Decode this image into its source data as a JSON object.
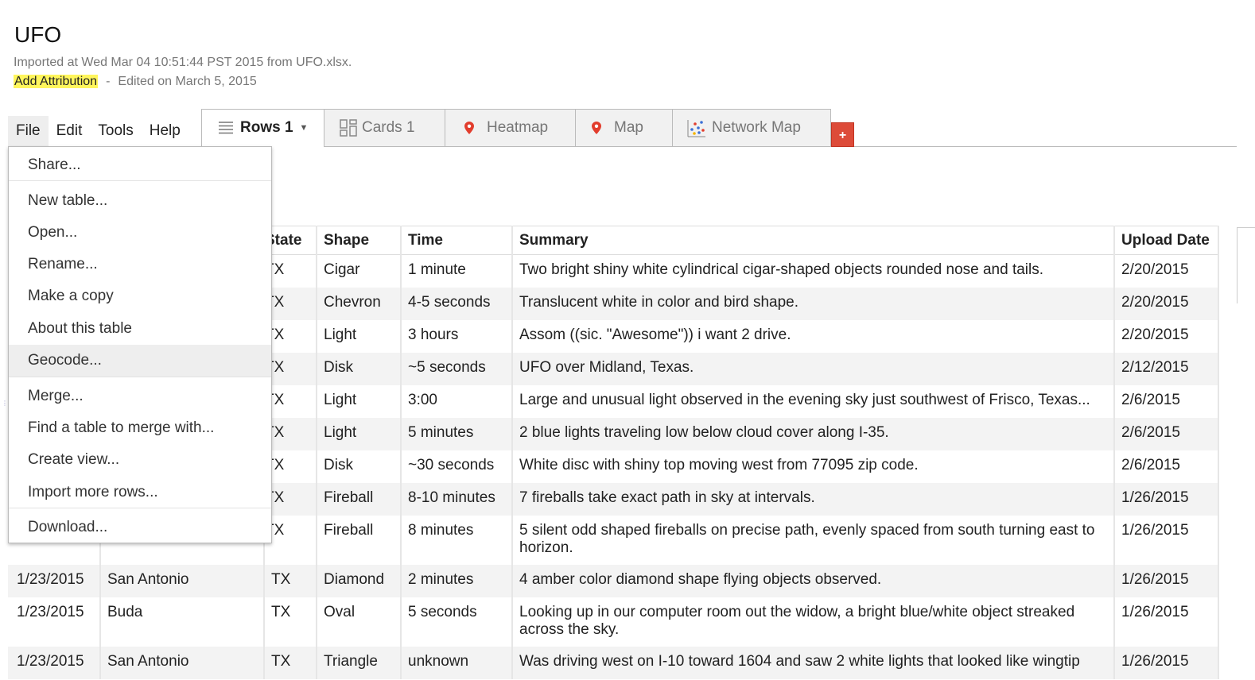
{
  "header": {
    "title": "UFO",
    "imported": "Imported at Wed Mar 04 10:51:44 PST 2015 from UFO.xlsx.",
    "attribution": "Add Attribution",
    "separator": "-",
    "edited": "Edited on March 5, 2015"
  },
  "menu": {
    "file": "File",
    "edit": "Edit",
    "tools": "Tools",
    "help": "Help"
  },
  "tabs": [
    {
      "label": "Rows 1",
      "icon": "rows-icon",
      "active": true
    },
    {
      "label": "Cards 1",
      "icon": "cards-icon"
    },
    {
      "label": "Heatmap",
      "icon": "map-pin-icon"
    },
    {
      "label": "Map",
      "icon": "map-pin-icon"
    },
    {
      "label": "Network Map",
      "icon": "network-icon"
    }
  ],
  "add_tab": "+",
  "file_menu": [
    "Share...",
    "New table...",
    "Open...",
    "Rename...",
    "Make a copy",
    "About this table",
    "Geocode...",
    "Merge...",
    "Find a table to merge with...",
    "Create view...",
    "Import more rows...",
    "Download..."
  ],
  "columns": [
    "",
    "",
    "State",
    "Shape",
    "Time",
    "Summary",
    "Upload Date"
  ],
  "rows": [
    [
      "",
      "",
      "TX",
      "Cigar",
      "1 minute",
      "Two bright shiny white cylindrical cigar-shaped objects rounded nose and tails.",
      "2/20/2015"
    ],
    [
      "",
      "",
      "TX",
      "Chevron",
      "4-5 seconds",
      "Translucent white in color and bird shape.",
      "2/20/2015"
    ],
    [
      "",
      "",
      "TX",
      "Light",
      "3 hours",
      "Assom ((sic. \"Awesome\")) i want 2 drive.",
      "2/20/2015"
    ],
    [
      "",
      "",
      "TX",
      "Disk",
      "~5 seconds",
      "UFO over Midland, Texas.",
      "2/12/2015"
    ],
    [
      "",
      "",
      "TX",
      "Light",
      "3:00",
      "Large and unusual light observed in the evening sky just southwest of Frisco, Texas...",
      "2/6/2015"
    ],
    [
      "",
      "",
      "TX",
      "Light",
      "5 minutes",
      "2 blue lights traveling low below cloud cover along I-35.",
      "2/6/2015"
    ],
    [
      "",
      "",
      "TX",
      "Disk",
      "~30 seconds",
      "White disc with shiny top moving west from 77095 zip code.",
      "2/6/2015"
    ],
    [
      "",
      "",
      "TX",
      "Fireball",
      "8-10 minutes",
      "7 fireballs take exact path in sky at intervals.",
      "1/26/2015"
    ],
    [
      "",
      "",
      "TX",
      "Fireball",
      "8 minutes",
      "5 silent odd shaped fireballs on precise path, evenly spaced from south turning east to horizon.",
      "1/26/2015"
    ],
    [
      "1/23/2015",
      "San Antonio",
      "TX",
      "Diamond",
      "2 minutes",
      "4 amber color diamond shape flying objects observed.",
      "1/26/2015"
    ],
    [
      "1/23/2015",
      "Buda",
      "TX",
      "Oval",
      "5 seconds",
      "Looking up in our computer room out the widow, a bright blue/white object streaked across the sky.",
      "1/26/2015"
    ],
    [
      "1/23/2015",
      "San Antonio",
      "TX",
      "Triangle",
      "unknown",
      "Was driving west on I-10 toward 1604 and saw 2 white lights that looked like wingtip",
      "1/26/2015"
    ]
  ],
  "colors": {
    "active_tab_bg": "#ffffff",
    "inactive_tab_bg": "#f1f1f1",
    "add_button": "#dd4b39",
    "highlight": "#fff65c"
  }
}
